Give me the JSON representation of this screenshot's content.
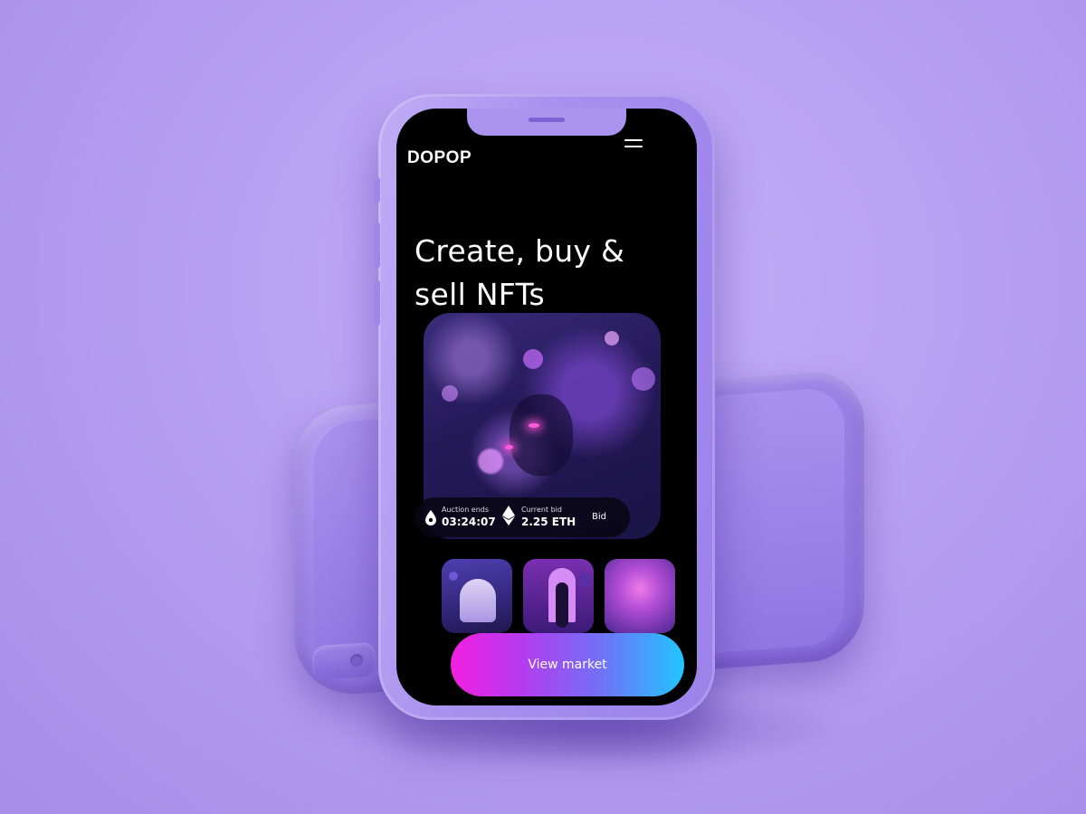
{
  "app": {
    "logo": "DOPOP",
    "menu_icon": "hamburger-menu-icon"
  },
  "hero": {
    "headline_line1": "Create, buy &",
    "headline_line2": "sell NFTs"
  },
  "auction": {
    "ends_label": "Auction ends",
    "ends_value": "03:24:07",
    "bid_label": "Current bid",
    "bid_value": "2.25 ETH",
    "bid_button": "Bid",
    "ends_icon": "drop-icon",
    "bid_icon": "ethereum-icon"
  },
  "cta": {
    "label": "View market"
  },
  "colors": {
    "background": "#b6a0f2",
    "screen": "#000000",
    "cta_start": "#f21fe0",
    "cta_end": "#21c5ff"
  }
}
